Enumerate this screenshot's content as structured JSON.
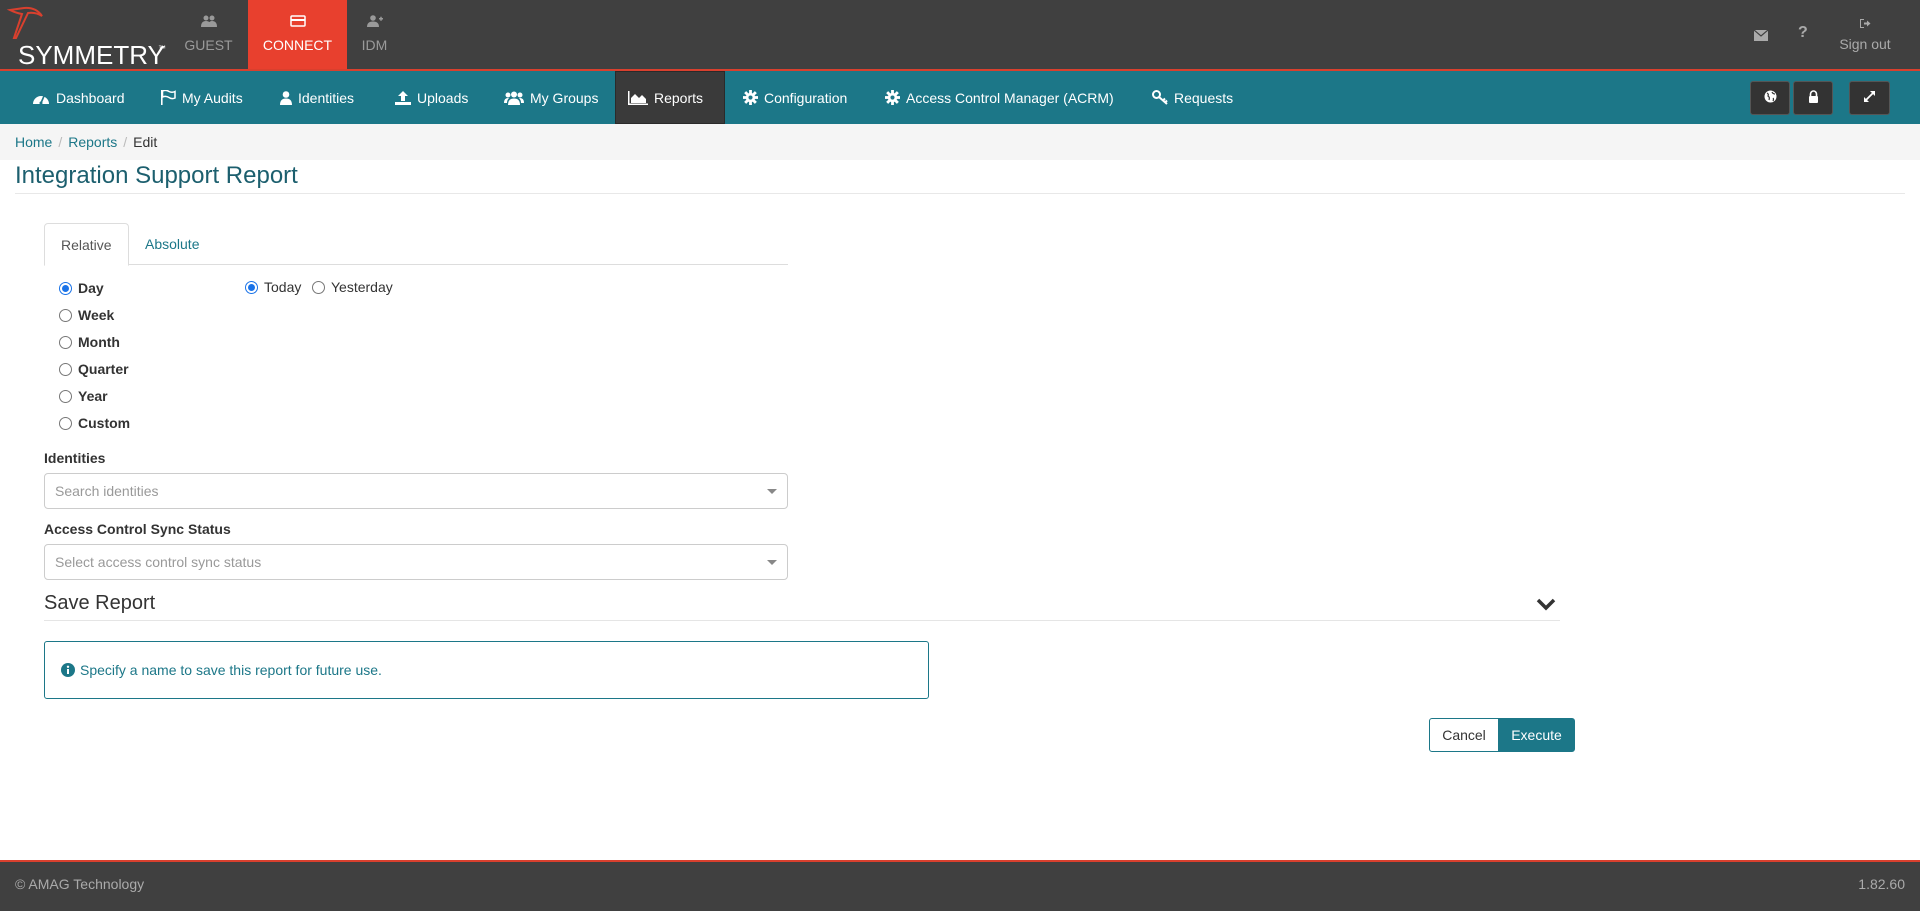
{
  "brand": {
    "name": "SYMMETRY",
    "tm": "™",
    "accent": "#e8402e",
    "nav_color": "#1c7788"
  },
  "app_tabs": [
    {
      "label": "GUEST",
      "icon": "users-icon"
    },
    {
      "label": "CONNECT",
      "icon": "card-icon",
      "active": true
    },
    {
      "label": "IDM",
      "icon": "user-plus-icon"
    }
  ],
  "top_right": {
    "mail_icon": "envelope-icon",
    "help_icon": "question-icon",
    "signout_label": "Sign out"
  },
  "nav": {
    "items": [
      {
        "label": "Dashboard",
        "icon": "dashboard-icon"
      },
      {
        "label": "My Audits",
        "icon": "flag-icon"
      },
      {
        "label": "Identities",
        "icon": "user-icon"
      },
      {
        "label": "Uploads",
        "icon": "upload-icon"
      },
      {
        "label": "My Groups",
        "icon": "users-icon"
      },
      {
        "label": "Reports",
        "icon": "area-chart-icon",
        "active": true
      },
      {
        "label": "Configuration",
        "icon": "gear-icon"
      },
      {
        "label": "Access Control Manager (ACRM)",
        "icon": "gear-icon"
      },
      {
        "label": "Requests",
        "icon": "key-icon"
      }
    ],
    "right_buttons": [
      "globe-icon",
      "lock-icon",
      "expand-icon"
    ]
  },
  "breadcrumb": [
    "Home",
    "Reports",
    "Edit"
  ],
  "page_title": "Integration Support Report",
  "tabs": [
    "Relative",
    "Absolute"
  ],
  "period_options": [
    "Day",
    "Week",
    "Month",
    "Quarter",
    "Year",
    "Custom"
  ],
  "selected_period": "Day",
  "day_options": [
    "Today",
    "Yesterday"
  ],
  "selected_day": "Today",
  "identities": {
    "label": "Identities",
    "placeholder": "Search identities"
  },
  "sync_status": {
    "label": "Access Control Sync Status",
    "placeholder": "Select access control sync status"
  },
  "save_report": {
    "heading": "Save Report",
    "info": "Specify a name to save this report for future use."
  },
  "actions": {
    "cancel": "Cancel",
    "execute": "Execute"
  },
  "footer": {
    "copyright": "© AMAG Technology",
    "version": "1.82.60"
  }
}
